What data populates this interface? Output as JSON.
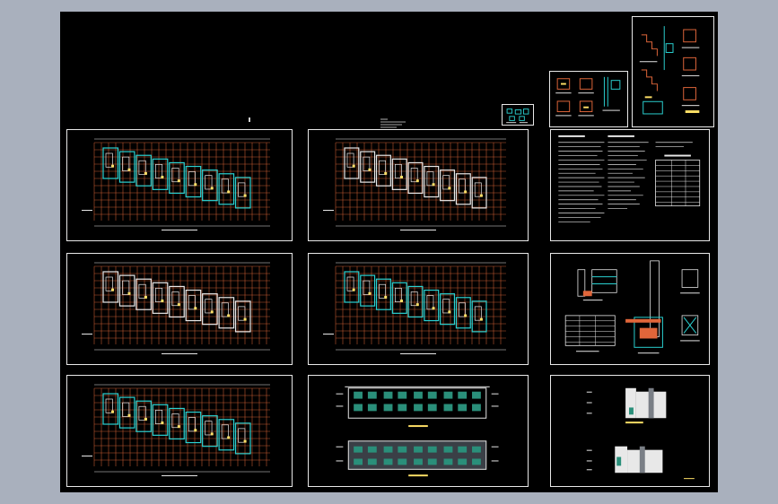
{
  "app": {
    "title": ""
  },
  "drawing": {
    "background": "#000000",
    "frame_color": "#e8e8e8",
    "grid_color": "#e0663a",
    "wall_color": "#2ad1d1",
    "accent_yellow": "#ffe066",
    "sheets": [
      {
        "id": "plan-1",
        "kind": "floor-plan"
      },
      {
        "id": "plan-2",
        "kind": "floor-plan"
      },
      {
        "id": "plan-3",
        "kind": "floor-plan"
      },
      {
        "id": "plan-4",
        "kind": "floor-plan"
      },
      {
        "id": "plan-5",
        "kind": "floor-plan"
      },
      {
        "id": "elevations-front",
        "kind": "elevation"
      },
      {
        "id": "design-notes",
        "kind": "notes-table"
      },
      {
        "id": "details-1",
        "kind": "details"
      },
      {
        "id": "elevations-side",
        "kind": "elevation"
      },
      {
        "id": "stair-details",
        "kind": "details"
      },
      {
        "id": "node-details",
        "kind": "details"
      },
      {
        "id": "legend-small",
        "kind": "detail-small"
      }
    ]
  }
}
